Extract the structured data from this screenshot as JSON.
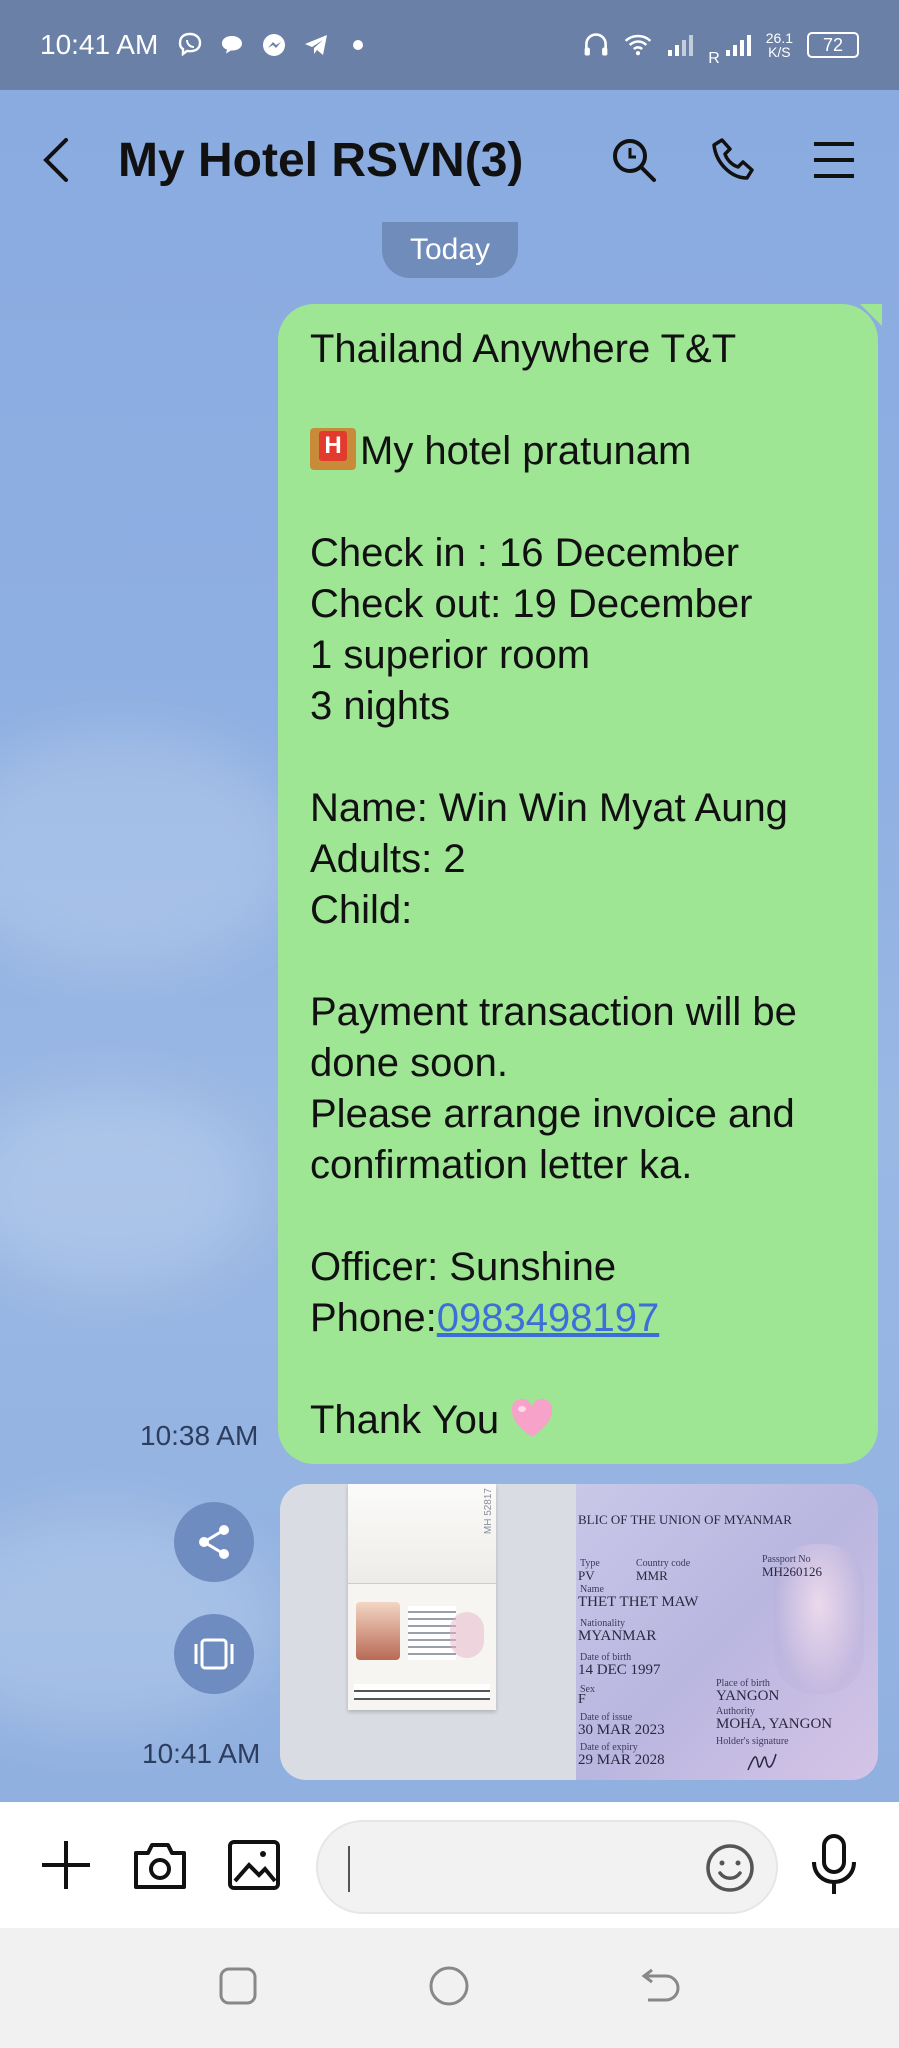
{
  "status_bar": {
    "time": "10:41 AM",
    "notification_icons": [
      "viber-icon",
      "chat-bubble-icon",
      "messenger-icon",
      "telegram-icon",
      "dot-icon"
    ],
    "speed_value": "26.1",
    "speed_unit": "K/S",
    "signal_label": "R",
    "battery": "72"
  },
  "header": {
    "title": "My Hotel RSVN(3)"
  },
  "date_chip": "Today",
  "message": {
    "lines": [
      "Thailand Anywhere T&T",
      "",
      "My hotel pratunam",
      "",
      "Check in : 16 December",
      "Check out: 19 December",
      "1 superior room",
      "3 nights",
      "",
      "Name: Win Win Myat Aung",
      "Adults: 2",
      "Child:",
      "",
      "Payment transaction will be",
      "done soon.",
      "Please arrange invoice and",
      "confirmation letter ka.",
      "",
      "Officer: Sunshine"
    ],
    "phone_prefix": "Phone:",
    "phone_number": "0983498197",
    "thanks": "Thank You",
    "time": "10:38 AM"
  },
  "photo_message": {
    "time": "10:41 AM",
    "passport": {
      "serial_vertical": "MH 52817",
      "header": "BLIC OF THE UNION OF MYANMAR",
      "type_label": "Type",
      "type": "PV",
      "country_label": "Country code",
      "country": "MMR",
      "passport_no_label": "Passport No",
      "passport_no": "MH260126",
      "name_label": "Name",
      "name": "THET THET MAW",
      "nationality_label": "Nationality",
      "nationality": "MYANMAR",
      "dob_label": "Date of birth",
      "dob": "14 DEC 1997",
      "sex_label": "Sex",
      "sex": "F",
      "pob_label": "Place of birth",
      "pob": "YANGON",
      "issue_label": "Date of issue",
      "issue": "30 MAR 2023",
      "authority_label": "Authority",
      "authority": "MOHA, YANGON",
      "expiry_label": "Date of expiry",
      "expiry": "29 MAR 2028",
      "signature_label": "Holder's signature"
    }
  },
  "colors": {
    "status_bar": "#6a80a6",
    "chat_background": "#8eaedf",
    "bubble": "#9ee594",
    "link": "#3c70d8",
    "date_chip": "#6f8cba"
  }
}
